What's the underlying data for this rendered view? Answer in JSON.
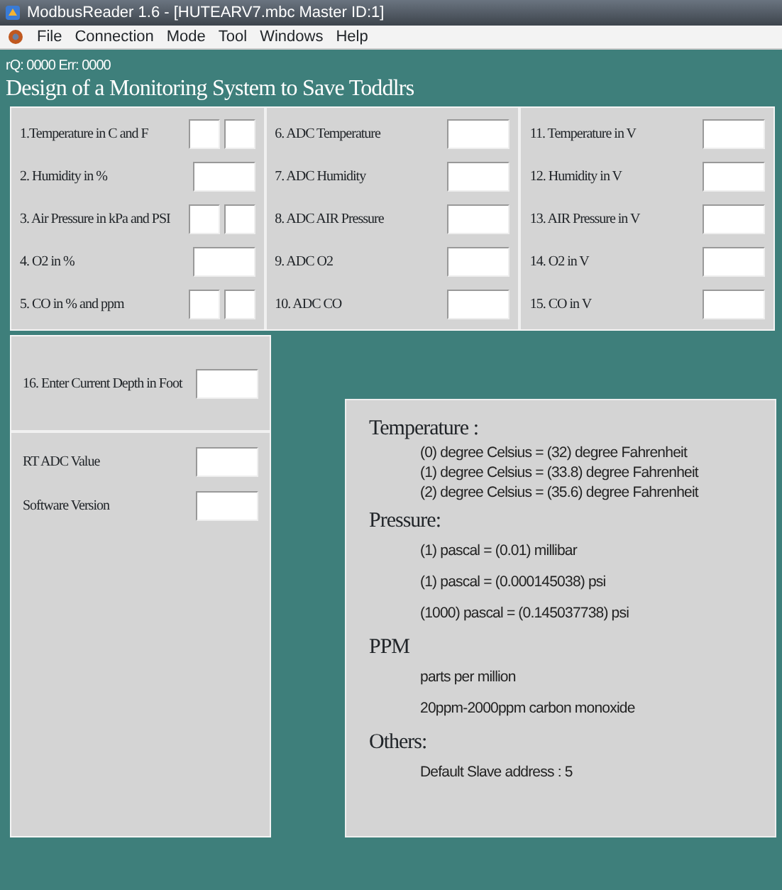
{
  "window": {
    "title": "ModbusReader 1.6 - [HUTEARV7.mbc Master ID:1]"
  },
  "menu": [
    "File",
    "Connection",
    "Mode",
    "Tool",
    "Windows",
    "Help"
  ],
  "status": "rQ: 0000 Err: 0000",
  "heading": "Design of a Monitoring System to Save Toddlrs",
  "columns": [
    [
      {
        "label": "1.Temperature in C and F",
        "kind": "pair"
      },
      {
        "label": "2. Humidity in %",
        "kind": "single"
      },
      {
        "label": "3. Air Pressure in kPa and PSI",
        "kind": "pair"
      },
      {
        "label": "4. O2 in %",
        "kind": "single"
      },
      {
        "label": "5. CO in % and ppm",
        "kind": "pair"
      }
    ],
    [
      {
        "label": "6. ADC Temperature",
        "kind": "single"
      },
      {
        "label": "7. ADC Humidity",
        "kind": "single"
      },
      {
        "label": "8. ADC AIR Pressure",
        "kind": "single"
      },
      {
        "label": "9. ADC O2",
        "kind": "single"
      },
      {
        "label": "10. ADC CO",
        "kind": "single"
      }
    ],
    [
      {
        "label": "11. Temperature in V",
        "kind": "single"
      },
      {
        "label": "12. Humidity in V",
        "kind": "single"
      },
      {
        "label": "13. AIR Pressure in V",
        "kind": "single"
      },
      {
        "label": "14. O2 in V",
        "kind": "single"
      },
      {
        "label": "15. CO in V",
        "kind": "single"
      }
    ]
  ],
  "depth": {
    "label": "16. Enter Current Depth in Foot"
  },
  "readouts": [
    {
      "label": "RT ADC Value"
    },
    {
      "label": "Software Version"
    }
  ],
  "info": [
    {
      "title": "Temperature :",
      "lines": [
        "(0) degree Celsius = (32) degree Fahrenheit",
        "(1) degree Celsius = (33.8) degree Fahrenheit",
        "(2) degree Celsius = (35.6) degree Fahrenheit"
      ],
      "kind": "tight"
    },
    {
      "title": "Pressure:",
      "lines": [
        "(1) pascal = (0.01) millibar",
        "(1) pascal = (0.000145038) psi",
        "(1000) pascal = (0.145037738) psi"
      ],
      "kind": "loose"
    },
    {
      "title": "PPM",
      "lines": [
        "parts per million",
        "20ppm-2000ppm carbon monoxide"
      ],
      "kind": "loose"
    },
    {
      "title": "Others:",
      "lines": [
        "Default Slave address : 5"
      ],
      "kind": "loose"
    }
  ]
}
